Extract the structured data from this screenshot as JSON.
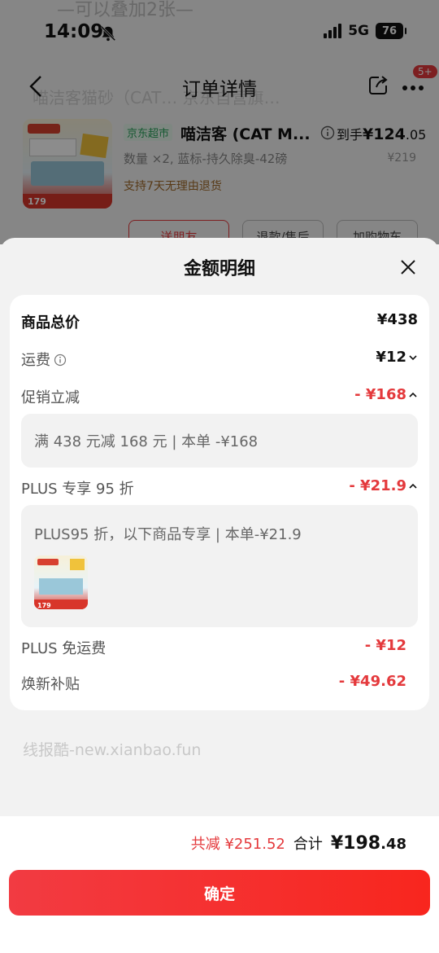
{
  "status_bar": {
    "time": "14:09",
    "network": "5G",
    "battery": "76"
  },
  "background": {
    "ghost_top": "—可以叠加2张—",
    "ghost_mid": "喵洁客猫砂（CAT… 京东自营旗…",
    "nav_title": "订单详情",
    "badge": "5+",
    "product": {
      "store_tag": "京东超市",
      "title": "喵洁客 (CAT M...",
      "daoshou_label": "到手",
      "daoshou_price_int": "¥124",
      "daoshou_price_dec": ".05",
      "spec": "数量 ×2, 蓝标-持久除臭-42磅",
      "orig_price": "¥219",
      "return_policy": "支持7天无理由退货",
      "thumb_price": "179"
    },
    "buttons": [
      "送朋友",
      "退款/售后",
      "加购物车"
    ]
  },
  "sheet": {
    "title": "金额明细",
    "rows": {
      "goods_total": {
        "label": "商品总价",
        "value": "¥438"
      },
      "shipping": {
        "label": "运费",
        "value": "¥12"
      },
      "promo": {
        "label": "促销立减",
        "value": "- ¥168",
        "detail": "满 438 元减 168 元 | 本单 -¥168"
      },
      "plus_discount": {
        "label": "PLUS 专享 95 折",
        "value": "- ¥21.9",
        "detail": "PLUS95 折，以下商品专享 | 本单-¥21.9",
        "thumb_price": "179"
      },
      "plus_shipping": {
        "label": "PLUS 免运费",
        "value": "- ¥12"
      },
      "trade_in": {
        "label": "焕新补贴",
        "value": "- ¥49.62"
      }
    },
    "watermark": "线报酷-new.xianbao.fun"
  },
  "footer": {
    "saved": "共减 ¥251.52",
    "total_label": "合计",
    "total_int": "¥198",
    "total_dec": ".48",
    "confirm_label": "确定"
  },
  "colors": {
    "accent_red": "#e4393c",
    "confirm_gradient": [
      "#f23b42",
      "#f8261e"
    ]
  }
}
